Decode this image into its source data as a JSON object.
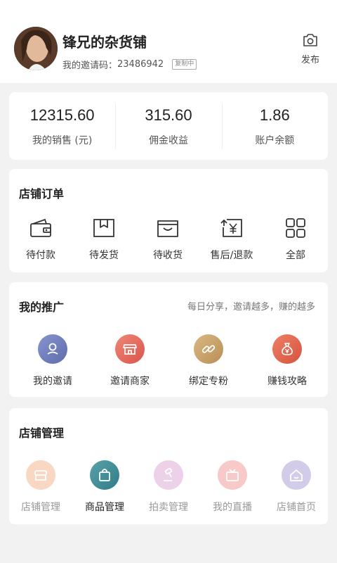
{
  "header": {
    "shop_name": "锋兄的杂货铺",
    "invite_label": "我的邀请码：",
    "invite_code": "23486942",
    "copy_badge": "复制中",
    "publish_label": "发布"
  },
  "stats": [
    {
      "value": "12315.60",
      "label": "我的销售 (元)"
    },
    {
      "value": "315.60",
      "label": "佣金收益"
    },
    {
      "value": "1.86",
      "label": "账户余额"
    }
  ],
  "orders": {
    "title": "店铺订单",
    "items": [
      {
        "label": "待付款",
        "icon": "wallet-icon"
      },
      {
        "label": "待发货",
        "icon": "package-icon"
      },
      {
        "label": "待收货",
        "icon": "receive-box-icon"
      },
      {
        "label": "售后/退款",
        "icon": "refund-icon"
      },
      {
        "label": "全部",
        "icon": "grid-icon"
      }
    ]
  },
  "promotion": {
    "title": "我的推广",
    "hint": "每日分享，邀请越多，赚的越多",
    "items": [
      {
        "label": "我的邀请",
        "icon": "user-icon",
        "color": "#6b7bbd"
      },
      {
        "label": "邀请商家",
        "icon": "shop-icon",
        "color": "#e46a5c"
      },
      {
        "label": "绑定专粉",
        "icon": "link-icon",
        "color": "#c8a36a"
      },
      {
        "label": "赚钱攻略",
        "icon": "money-bag-icon",
        "color": "#e0674e"
      }
    ]
  },
  "management": {
    "title": "店铺管理",
    "items": [
      {
        "label": "店铺管理",
        "icon": "store-icon",
        "color": "#f0a77c",
        "active": false
      },
      {
        "label": "商品管理",
        "icon": "bag-icon",
        "color": "#3f8f9a",
        "active": true
      },
      {
        "label": "拍卖管理",
        "icon": "gavel-icon",
        "color": "#d79ad0",
        "active": false
      },
      {
        "label": "我的直播",
        "icon": "tv-icon",
        "color": "#ef8a8a",
        "active": false
      },
      {
        "label": "店铺首页",
        "icon": "home-icon",
        "color": "#9d90cf",
        "active": false
      }
    ]
  }
}
